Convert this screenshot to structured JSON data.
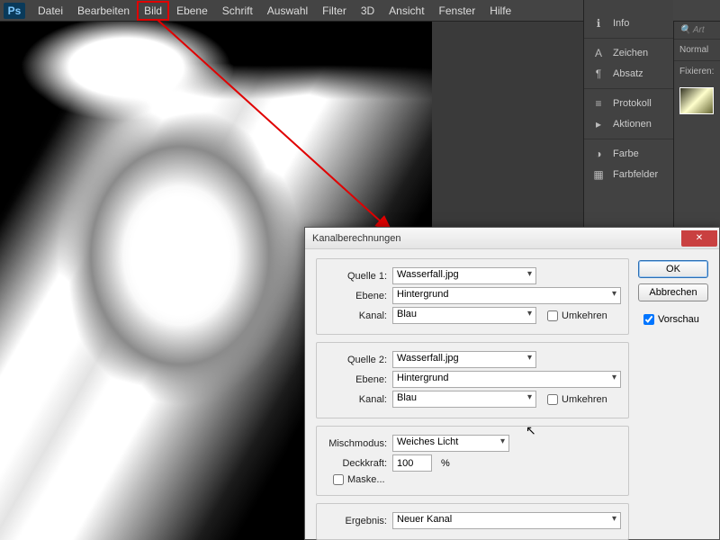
{
  "menu": {
    "items": [
      "Datei",
      "Bearbeiten",
      "Bild",
      "Ebene",
      "Schrift",
      "Auswahl",
      "Filter",
      "3D",
      "Ansicht",
      "Fenster",
      "Hilfe"
    ],
    "highlighted_index": 2
  },
  "panels": {
    "info": "Info",
    "zeichen": "Zeichen",
    "absatz": "Absatz",
    "protokoll": "Protokoll",
    "aktionen": "Aktionen",
    "farbe": "Farbe",
    "farbfelder": "Farbfelder"
  },
  "rstrip": {
    "search_placeholder": "Art",
    "mode": "Normal",
    "lock_label": "Fixieren:"
  },
  "dialog": {
    "title": "Kanalberechnungen",
    "source1": {
      "label": "Quelle 1:",
      "file": "Wasserfall.jpg",
      "layer_label": "Ebene:",
      "layer": "Hintergrund",
      "channel_label": "Kanal:",
      "channel": "Blau",
      "invert_label": "Umkehren"
    },
    "source2": {
      "label": "Quelle 2:",
      "file": "Wasserfall.jpg",
      "layer_label": "Ebene:",
      "layer": "Hintergrund",
      "channel_label": "Kanal:",
      "channel": "Blau",
      "invert_label": "Umkehren"
    },
    "blend": {
      "mode_label": "Mischmodus:",
      "mode": "Weiches Licht",
      "opacity_label": "Deckkraft:",
      "opacity_value": "100",
      "opacity_unit": "%",
      "mask_label": "Maske..."
    },
    "result": {
      "label": "Ergebnis:",
      "value": "Neuer Kanal"
    },
    "buttons": {
      "ok": "OK",
      "cancel": "Abbrechen",
      "preview": "Vorschau"
    }
  }
}
